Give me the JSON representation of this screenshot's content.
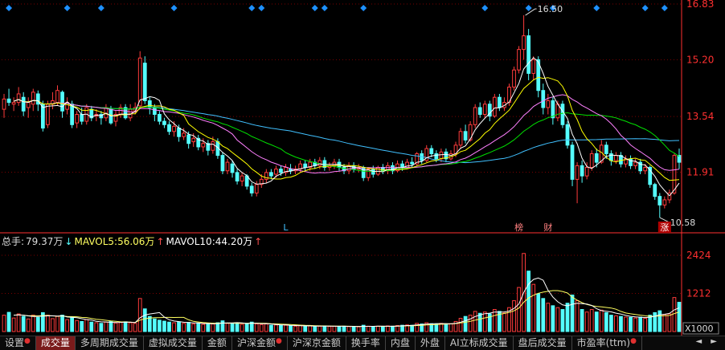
{
  "title_fragment": "",
  "colors": {
    "up": "#ff3c3c",
    "down": "#54ffff",
    "ma5": "#ffffff",
    "ma10": "#ffff00",
    "ma20": "#ff80ff",
    "ma30": "#00e000",
    "ma60": "#40c0ff",
    "axis": "#ff3030",
    "grid": "#7a0000",
    "marker": "#1e90ff"
  },
  "chart_data": {
    "type": "candlestick",
    "price_axis": {
      "ticks": [
        "16.83",
        "15.20",
        "13.54",
        "11.91"
      ],
      "tick_values": [
        16.83,
        15.2,
        13.54,
        11.91
      ],
      "ylim": [
        10.3,
        16.83
      ]
    },
    "annotations": {
      "high_label": "16.50",
      "high_value": 16.5,
      "low_label": "10.58",
      "low_value": 10.58,
      "bottom_markers": [
        {
          "text": "L",
          "bar": 58,
          "color": "#40c0ff"
        },
        {
          "text": "榜",
          "bar": 106,
          "color": "#ff8080"
        },
        {
          "text": "财",
          "bar": 112,
          "color": "#ff8080"
        },
        {
          "text": "涨",
          "bar": 136,
          "color": "#ffffff",
          "boxed": true
        }
      ],
      "top_marker_bars": [
        1,
        13,
        20,
        35,
        51,
        53,
        64,
        66,
        74,
        99,
        108,
        113,
        122,
        132,
        136
      ]
    },
    "volume_header": {
      "total_label": "总手:",
      "total_value": "79.37万",
      "total_arrow": "↓",
      "mavol5_label": "MAVOL5:",
      "mavol5_value": "56.06万",
      "mavol5_arrow": "↑",
      "mavol10_label": "MAVOL10:",
      "mavol10_value": "44.20万",
      "mavol10_arrow": "↑"
    },
    "volume_axis": {
      "ticks": [
        "2424",
        "1212"
      ],
      "tick_values": [
        2424,
        1212
      ],
      "unit": "X1000",
      "ylim": [
        0,
        2550
      ]
    },
    "candles": [
      [
        13.75,
        14.05,
        14.2,
        13.5,
        520
      ],
      [
        14.05,
        13.95,
        14.35,
        13.85,
        610
      ],
      [
        13.9,
        13.95,
        14.1,
        13.7,
        430
      ],
      [
        13.95,
        14.2,
        14.4,
        13.85,
        560
      ],
      [
        14.1,
        13.7,
        14.25,
        13.55,
        480
      ],
      [
        13.8,
        13.95,
        14.1,
        13.5,
        400
      ],
      [
        13.9,
        14.25,
        14.35,
        13.7,
        520
      ],
      [
        14.2,
        13.9,
        14.3,
        13.7,
        450
      ],
      [
        13.9,
        13.2,
        14.0,
        13.1,
        600
      ],
      [
        13.3,
        13.9,
        14.0,
        13.2,
        520
      ],
      [
        13.9,
        14.0,
        14.25,
        13.75,
        410
      ],
      [
        13.95,
        14.3,
        14.45,
        13.85,
        480
      ],
      [
        14.25,
        13.7,
        14.3,
        13.5,
        520
      ],
      [
        13.75,
        13.95,
        14.1,
        13.6,
        380
      ],
      [
        13.9,
        13.3,
        14.0,
        13.2,
        470
      ],
      [
        13.35,
        13.6,
        13.7,
        13.2,
        350
      ],
      [
        13.6,
        13.4,
        13.8,
        13.3,
        320
      ],
      [
        13.4,
        13.8,
        13.9,
        13.3,
        380
      ],
      [
        13.75,
        13.5,
        13.85,
        13.4,
        300
      ],
      [
        13.55,
        13.6,
        13.75,
        13.4,
        280
      ],
      [
        13.6,
        13.5,
        13.7,
        13.3,
        260
      ],
      [
        13.5,
        13.8,
        13.9,
        13.4,
        300
      ],
      [
        13.75,
        13.35,
        13.85,
        13.3,
        330
      ],
      [
        13.4,
        13.6,
        13.7,
        13.25,
        270
      ],
      [
        13.6,
        13.8,
        13.9,
        13.5,
        290
      ],
      [
        13.8,
        13.5,
        13.9,
        13.45,
        310
      ],
      [
        13.5,
        13.75,
        13.9,
        13.4,
        280
      ],
      [
        13.7,
        13.8,
        13.95,
        13.6,
        260
      ],
      [
        13.85,
        15.25,
        15.45,
        13.8,
        1050
      ],
      [
        15.1,
        14.0,
        15.3,
        13.9,
        720
      ],
      [
        14.0,
        13.8,
        14.1,
        13.6,
        480
      ],
      [
        13.8,
        13.6,
        13.9,
        13.4,
        400
      ],
      [
        13.6,
        13.4,
        13.7,
        13.3,
        360
      ],
      [
        13.4,
        13.3,
        13.5,
        13.2,
        330
      ],
      [
        13.3,
        13.1,
        13.4,
        13.0,
        300
      ],
      [
        13.1,
        13.25,
        13.4,
        12.95,
        280
      ],
      [
        13.2,
        12.95,
        13.3,
        12.8,
        310
      ],
      [
        12.95,
        13.05,
        13.2,
        12.85,
        260
      ],
      [
        13.0,
        12.75,
        13.1,
        12.6,
        290
      ],
      [
        12.8,
        12.9,
        13.05,
        12.65,
        240
      ],
      [
        12.9,
        12.65,
        13.0,
        12.55,
        260
      ],
      [
        12.65,
        12.75,
        12.9,
        12.5,
        230
      ],
      [
        12.75,
        12.55,
        12.85,
        12.4,
        250
      ],
      [
        12.55,
        12.8,
        12.95,
        12.45,
        240
      ],
      [
        12.8,
        12.4,
        12.9,
        12.3,
        280
      ],
      [
        12.4,
        11.95,
        12.5,
        11.85,
        340
      ],
      [
        11.95,
        12.2,
        12.3,
        11.85,
        260
      ],
      [
        12.15,
        11.9,
        12.25,
        11.75,
        250
      ],
      [
        11.9,
        11.65,
        12.0,
        11.55,
        280
      ],
      [
        11.65,
        11.8,
        11.9,
        11.5,
        230
      ],
      [
        11.8,
        11.5,
        11.85,
        11.4,
        260
      ],
      [
        11.5,
        11.3,
        11.6,
        11.2,
        300
      ],
      [
        11.3,
        11.55,
        11.65,
        11.2,
        240
      ],
      [
        11.55,
        11.7,
        11.85,
        11.45,
        220
      ],
      [
        11.7,
        11.9,
        12.0,
        11.6,
        240
      ],
      [
        11.9,
        11.8,
        12.0,
        11.7,
        200
      ],
      [
        11.85,
        12.0,
        12.1,
        11.75,
        210
      ],
      [
        12.0,
        11.9,
        12.1,
        11.8,
        190
      ],
      [
        11.9,
        12.05,
        12.15,
        11.8,
        200
      ],
      [
        12.0,
        11.95,
        12.15,
        11.85,
        180
      ],
      [
        11.95,
        12.0,
        12.1,
        11.85,
        170
      ],
      [
        12.0,
        12.15,
        12.25,
        11.9,
        190
      ],
      [
        12.15,
        12.05,
        12.25,
        11.95,
        170
      ],
      [
        12.05,
        12.2,
        12.3,
        11.95,
        180
      ],
      [
        12.2,
        12.1,
        12.3,
        12.0,
        160
      ],
      [
        12.1,
        12.25,
        12.35,
        12.0,
        170
      ],
      [
        12.25,
        12.05,
        12.35,
        11.95,
        180
      ],
      [
        12.05,
        12.1,
        12.2,
        11.95,
        160
      ],
      [
        12.1,
        12.2,
        12.3,
        12.0,
        170
      ],
      [
        12.2,
        12.05,
        12.3,
        11.95,
        160
      ],
      [
        12.05,
        11.95,
        12.15,
        11.85,
        170
      ],
      [
        11.95,
        12.1,
        12.2,
        11.85,
        160
      ],
      [
        12.1,
        12.0,
        12.2,
        11.9,
        150
      ],
      [
        12.0,
        12.05,
        12.15,
        11.9,
        150
      ],
      [
        12.05,
        11.75,
        12.1,
        11.65,
        200
      ],
      [
        11.75,
        12.0,
        12.05,
        11.65,
        170
      ],
      [
        12.0,
        11.85,
        12.1,
        11.75,
        160
      ],
      [
        11.85,
        12.05,
        12.1,
        11.8,
        170
      ],
      [
        12.05,
        11.95,
        12.15,
        11.85,
        160
      ],
      [
        11.95,
        12.1,
        12.2,
        11.85,
        180
      ],
      [
        12.1,
        11.95,
        12.2,
        11.85,
        170
      ],
      [
        11.95,
        12.15,
        12.25,
        11.9,
        190
      ],
      [
        12.15,
        12.05,
        12.25,
        11.95,
        200
      ],
      [
        12.05,
        12.2,
        12.3,
        12.0,
        210
      ],
      [
        12.2,
        12.15,
        12.35,
        12.05,
        200
      ],
      [
        12.15,
        12.45,
        12.5,
        12.1,
        260
      ],
      [
        12.45,
        12.25,
        12.55,
        12.15,
        240
      ],
      [
        12.25,
        12.6,
        12.7,
        12.2,
        280
      ],
      [
        12.6,
        12.45,
        12.7,
        12.35,
        250
      ],
      [
        12.45,
        12.3,
        12.55,
        12.2,
        230
      ],
      [
        12.3,
        12.5,
        12.6,
        12.2,
        260
      ],
      [
        12.5,
        12.3,
        12.6,
        12.2,
        240
      ],
      [
        12.3,
        12.45,
        12.55,
        12.25,
        250
      ],
      [
        12.45,
        12.7,
        12.8,
        12.35,
        320
      ],
      [
        12.7,
        13.1,
        13.2,
        12.6,
        420
      ],
      [
        13.1,
        12.85,
        13.3,
        12.75,
        480
      ],
      [
        12.85,
        13.3,
        13.4,
        12.8,
        520
      ],
      [
        13.3,
        13.8,
        13.9,
        13.2,
        640
      ],
      [
        13.8,
        13.6,
        13.95,
        13.5,
        580
      ],
      [
        13.6,
        13.9,
        14.0,
        13.5,
        620
      ],
      [
        13.9,
        13.55,
        14.0,
        13.4,
        560
      ],
      [
        13.55,
        14.1,
        14.2,
        13.5,
        700
      ],
      [
        14.1,
        13.8,
        14.2,
        13.7,
        640
      ],
      [
        13.8,
        13.95,
        14.1,
        13.7,
        590
      ],
      [
        13.95,
        14.4,
        14.5,
        13.85,
        760
      ],
      [
        14.4,
        14.9,
        15.0,
        14.3,
        980
      ],
      [
        14.9,
        15.5,
        15.6,
        14.8,
        1400
      ],
      [
        15.5,
        15.9,
        16.5,
        15.2,
        2480
      ],
      [
        15.9,
        14.8,
        16.1,
        14.6,
        1920
      ],
      [
        14.8,
        15.2,
        15.3,
        14.6,
        1500
      ],
      [
        15.2,
        14.3,
        15.3,
        14.1,
        1200
      ],
      [
        14.3,
        13.8,
        14.5,
        13.6,
        1050
      ],
      [
        13.8,
        14.0,
        14.2,
        13.6,
        900
      ],
      [
        14.0,
        13.5,
        14.1,
        13.3,
        820
      ],
      [
        13.5,
        13.9,
        14.0,
        13.4,
        760
      ],
      [
        13.9,
        13.3,
        14.0,
        13.2,
        700
      ],
      [
        13.3,
        12.7,
        13.4,
        12.6,
        900
      ],
      [
        12.7,
        11.7,
        12.8,
        11.5,
        1160
      ],
      [
        11.7,
        12.1,
        12.2,
        11.0,
        980
      ],
      [
        12.1,
        11.8,
        12.25,
        11.6,
        700
      ],
      [
        11.8,
        12.05,
        12.2,
        11.7,
        620
      ],
      [
        12.05,
        12.45,
        12.55,
        11.95,
        700
      ],
      [
        12.45,
        12.2,
        12.6,
        12.05,
        620
      ],
      [
        12.2,
        12.7,
        12.85,
        12.15,
        680
      ],
      [
        12.7,
        12.45,
        12.8,
        12.3,
        600
      ],
      [
        12.45,
        12.25,
        12.55,
        12.1,
        520
      ],
      [
        12.25,
        12.4,
        12.5,
        12.15,
        500
      ],
      [
        12.4,
        12.15,
        12.5,
        12.05,
        480
      ],
      [
        12.15,
        12.3,
        12.4,
        12.05,
        460
      ],
      [
        12.3,
        12.1,
        12.4,
        12.0,
        450
      ],
      [
        12.1,
        12.2,
        12.3,
        12.0,
        430
      ],
      [
        12.2,
        11.95,
        12.3,
        11.85,
        460
      ],
      [
        11.95,
        12.05,
        12.15,
        11.85,
        420
      ],
      [
        12.05,
        11.55,
        12.1,
        11.45,
        520
      ],
      [
        11.55,
        11.2,
        11.6,
        11.1,
        600
      ],
      [
        11.2,
        10.95,
        11.3,
        10.58,
        660
      ],
      [
        10.95,
        11.1,
        11.2,
        10.85,
        540
      ],
      [
        11.1,
        11.3,
        11.4,
        11.0,
        560
      ],
      [
        11.3,
        12.4,
        12.45,
        11.25,
        1080
      ],
      [
        12.4,
        12.2,
        12.6,
        12.0,
        930
      ]
    ]
  },
  "tabs": [
    {
      "label": "设置",
      "dot": true
    },
    {
      "label": "成交量",
      "active": true
    },
    {
      "label": "多周期成交量"
    },
    {
      "label": "虚拟成交量"
    },
    {
      "label": "金额"
    },
    {
      "label": "沪深金额",
      "dot": true
    },
    {
      "label": "沪深京金额"
    },
    {
      "label": "换手率"
    },
    {
      "label": "内盘"
    },
    {
      "label": "外盘"
    },
    {
      "label": "AI立标成交量"
    },
    {
      "label": "盘后成交量"
    },
    {
      "label": "市盈率(ttm)",
      "dot": true
    }
  ],
  "scroll_arrows": "◄ ►"
}
